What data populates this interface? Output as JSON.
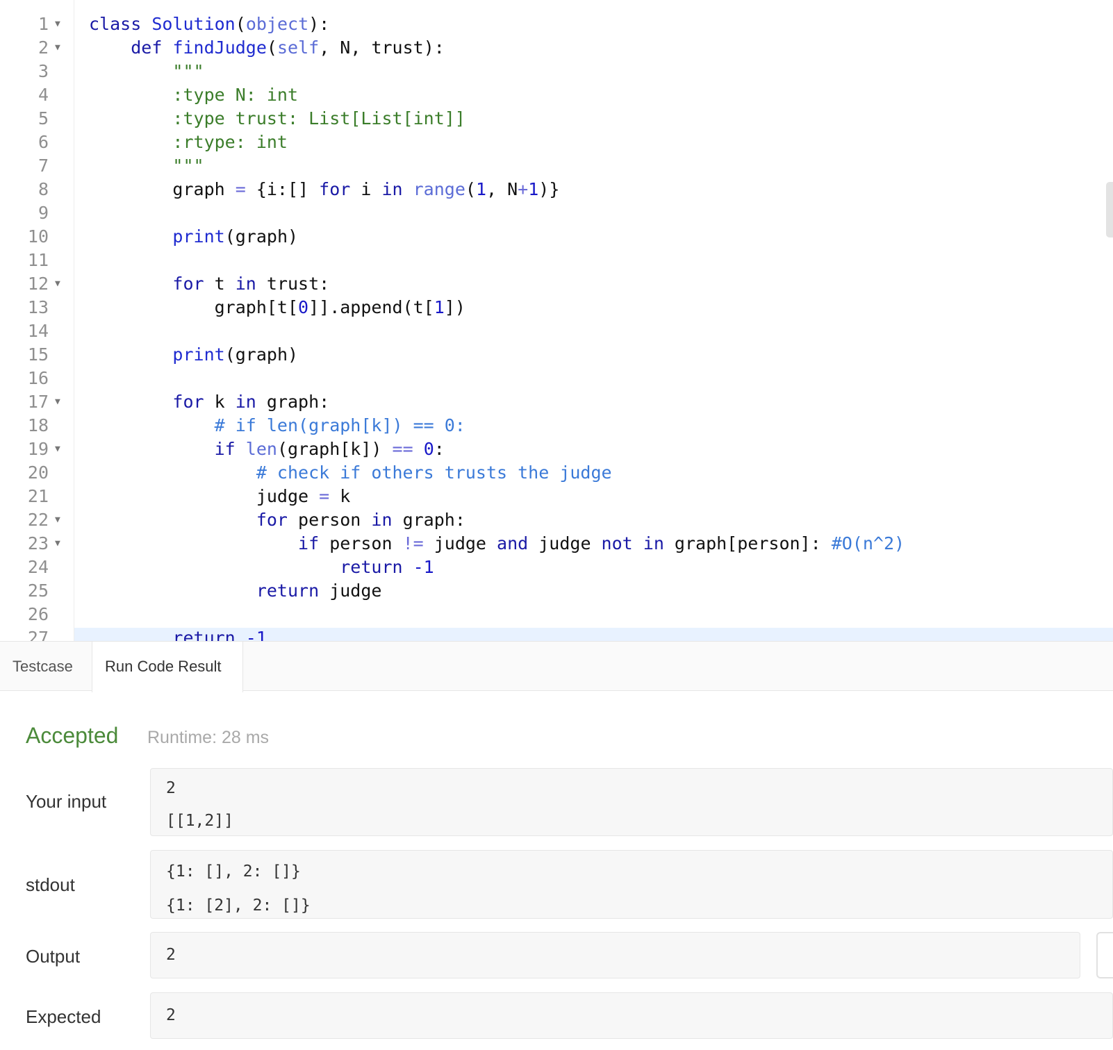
{
  "editor": {
    "line_numbers": [
      "1",
      "2",
      "3",
      "4",
      "5",
      "6",
      "7",
      "8",
      "9",
      "10",
      "11",
      "12",
      "13",
      "14",
      "15",
      "16",
      "17",
      "18",
      "19",
      "20",
      "21",
      "22",
      "23",
      "24",
      "25",
      "26",
      "27"
    ],
    "fold_icon": "triangle-down-icon"
  },
  "tabs": {
    "testcase": "Testcase",
    "run_code_result": "Run Code Result"
  },
  "result": {
    "status": "Accepted",
    "runtime": "Runtime: 28 ms",
    "your_input_label": "Your input",
    "your_input_line1": "2",
    "your_input_line2": "[[1,2]]",
    "stdout_label": "stdout",
    "stdout_line1": "{1: [], 2: []}",
    "stdout_line2": "{1: [2], 2: []}",
    "output_label": "Output",
    "output_value": "2",
    "expected_label": "Expected",
    "expected_value": "2"
  },
  "colors": {
    "accepted": "#4b8a3a",
    "keyword": "#1a1aa6",
    "docstring": "#3b7d2a",
    "comment": "#3b7ad8"
  }
}
